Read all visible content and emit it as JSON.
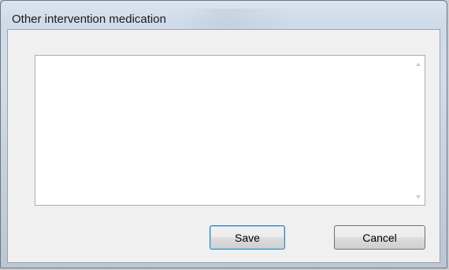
{
  "dialog": {
    "title": "Other intervention medication",
    "textarea_value": "",
    "save_label": "Save",
    "cancel_label": "Cancel"
  },
  "colors": {
    "frame": "#cfdbea",
    "client_bg": "#f0f0f0",
    "default_button_border": "#3c7fb1"
  }
}
